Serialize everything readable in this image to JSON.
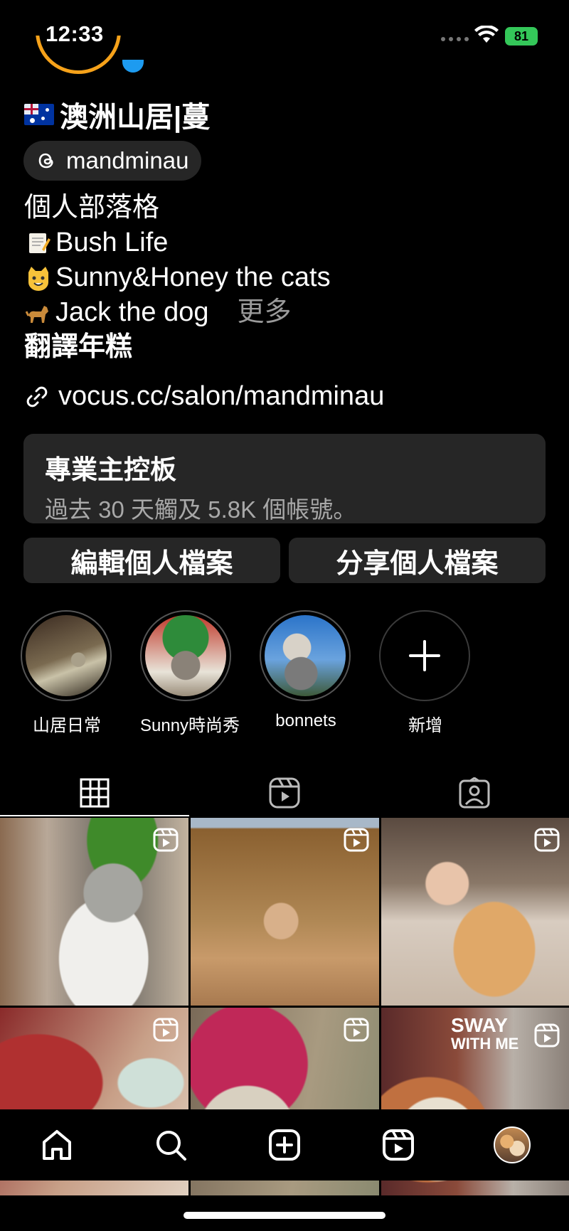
{
  "status": {
    "time": "12:33",
    "battery": "81"
  },
  "profile": {
    "name": "澳洲山居|蔓",
    "threads_handle": "mandminau",
    "bio_lines": [
      "個人部落格",
      "Bush Life",
      "Sunny&Honey the cats",
      "Jack the dog"
    ],
    "more_label": "更多",
    "bold_line": "翻譯年糕",
    "link": "vocus.cc/salon/mandminau"
  },
  "dashboard": {
    "title": "專業主控板",
    "subtitle": "過去 30 天觸及 5.8K 個帳號。"
  },
  "buttons": {
    "edit": "編輯個人檔案",
    "share": "分享個人檔案"
  },
  "highlights": [
    {
      "label": "山居日常"
    },
    {
      "label": "Sunny時尚秀"
    },
    {
      "label": "bonnets"
    },
    {
      "label": "新增"
    }
  ],
  "grid_overlay_text": [
    "SWAY",
    "WITH ME"
  ],
  "icons": [
    "flag-australia-icon",
    "threads-icon",
    "memo-icon",
    "cat-face-icon",
    "dog-icon",
    "link-icon",
    "add-icon",
    "grid-icon",
    "reels-icon",
    "tagged-icon",
    "reel-badge-icon",
    "home-icon",
    "search-icon",
    "create-icon",
    "profile-avatar"
  ],
  "colors": {
    "background": "#000000",
    "surface": "#262626",
    "secondary_text": "#a8a8a8",
    "battery": "#34c759",
    "accent_ring": "#f6a21a"
  }
}
